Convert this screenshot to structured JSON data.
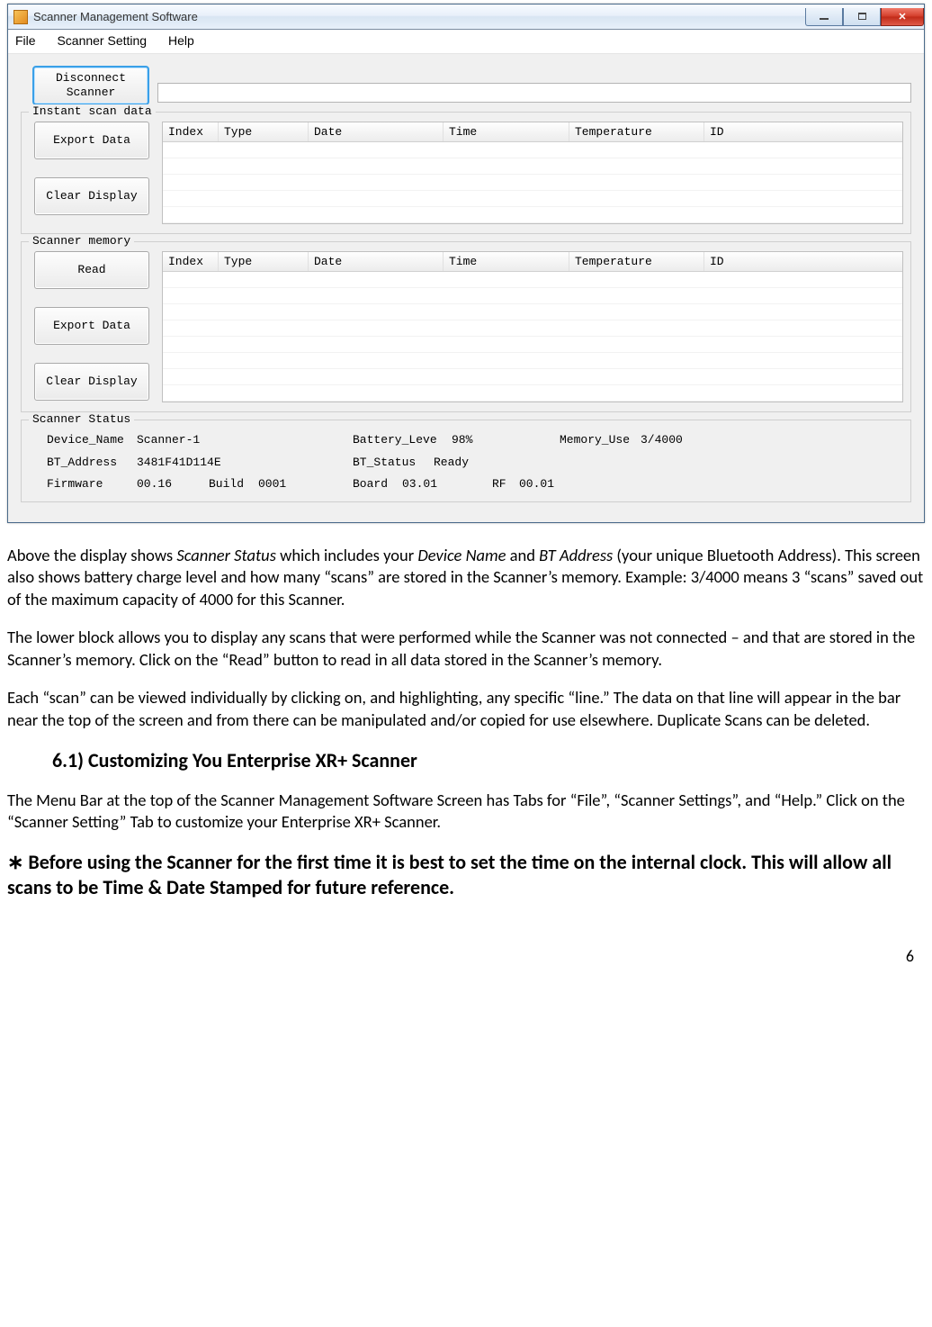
{
  "window": {
    "title": "Scanner Management Software",
    "menu": {
      "file": "File",
      "scanner_setting": "Scanner Setting",
      "help": "Help"
    }
  },
  "buttons": {
    "disconnect": "Disconnect\nScanner",
    "export_data": "Export Data",
    "clear_display": "Clear Display",
    "read": "Read",
    "export_data2": "Export Data",
    "clear_display2": "Clear Display"
  },
  "groups": {
    "instant": "Instant scan data",
    "memory": "Scanner memory",
    "status": "Scanner Status"
  },
  "table_columns": {
    "index": "Index",
    "type": "Type",
    "date": "Date",
    "time": "Time",
    "temperature": "Temperature",
    "id": "ID"
  },
  "status": {
    "device_name_label": "Device_Name",
    "device_name_value": "Scanner-1",
    "battery_label": "Battery_Leve",
    "battery_value": "98%",
    "memory_use_label": "Memory_Use",
    "memory_use_value": "3/4000",
    "bt_address_label": "BT_Address",
    "bt_address_value": "3481F41D114E",
    "bt_status_label": "BT_Status",
    "bt_status_value": "Ready",
    "firmware_label": "Firmware",
    "firmware_value": "00.16",
    "build_label": "Build",
    "build_value": "0001",
    "board_label": "Board",
    "board_value": "03.01",
    "rf_label": "RF",
    "rf_value": "00.01"
  },
  "doc": {
    "p1_a": "Above the display shows ",
    "p1_b": "Scanner Status",
    "p1_c": " which includes your ",
    "p1_d": "Device Name",
    "p1_e": " and ",
    "p1_f": "BT Address",
    "p1_g": " (your unique Bluetooth Address).  This screen also shows battery charge level and how many “scans” are stored in the Scanner’s memory.  Example:  3/4000 means 3 “scans” saved out of the maximum capacity of 4000 for this Scanner.",
    "p2": "The lower block allows you to display any scans that were performed while the Scanner was not connected – and that are stored in the Scanner’s memory.  Click on the “Read” button to read in all data stored in the Scanner’s memory.",
    "p3": "Each “scan” can be viewed individually by clicking on, and highlighting, any specific “line.”  The data on that line will appear in the bar near the top of the screen and from there can be manipulated and/or copied for use elsewhere.  Duplicate Scans can be deleted.",
    "h3": "6.1) Customizing You Enterprise XR+ Scanner",
    "p4": "The Menu Bar at the top of the Scanner Management Software Screen has Tabs for “File”, “Scanner Settings”, and “Help.”  Click on the “Scanner Setting” Tab to customize your Enterprise XR+ Scanner.",
    "p5": "∗ Before using the Scanner for the first time it is best to set the time on the internal clock.  This will allow all scans to be Time & Date Stamped for future reference.",
    "page_num": "6"
  }
}
